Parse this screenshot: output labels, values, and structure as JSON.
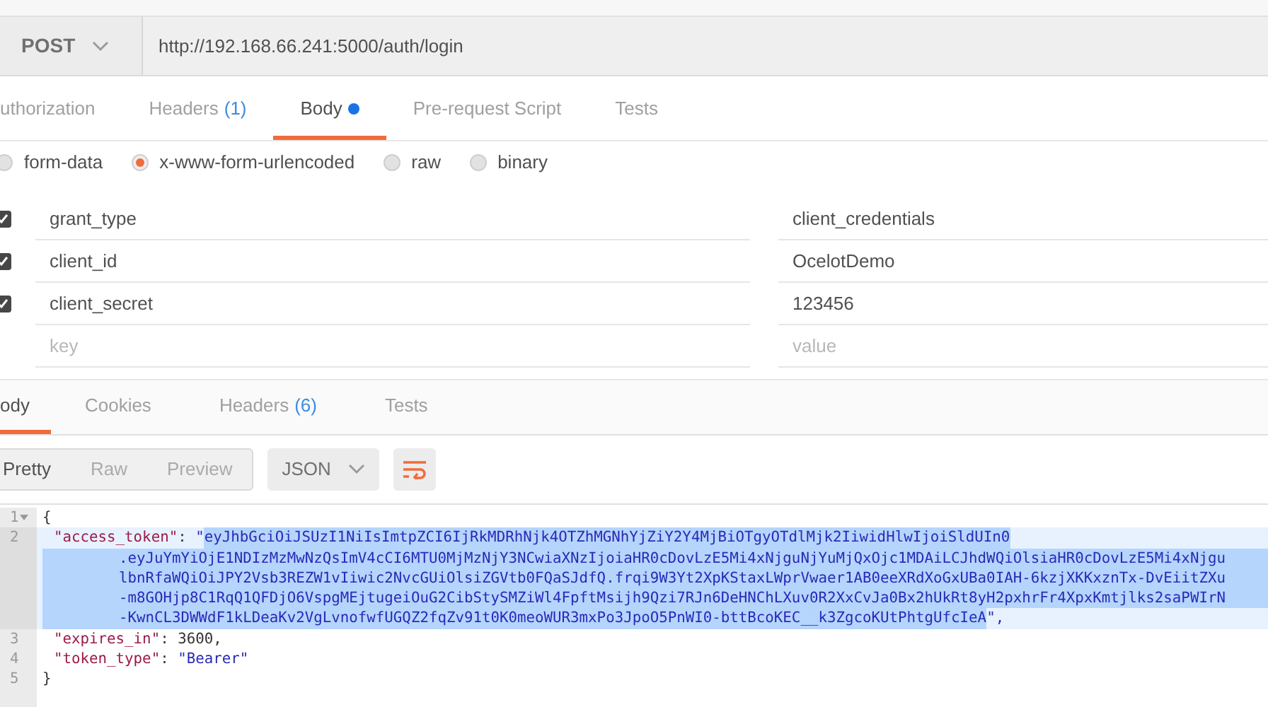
{
  "request": {
    "method": "POST",
    "url": "http://192.168.66.241:5000/auth/login"
  },
  "request_tabs": [
    {
      "label": "uthorization",
      "dot": false,
      "selected": false
    },
    {
      "label": "Headers",
      "count": "(1)",
      "dot": false,
      "selected": false
    },
    {
      "label": "Body",
      "dot": true,
      "selected": true
    },
    {
      "label": "Pre-request Script",
      "dot": false,
      "selected": false
    },
    {
      "label": "Tests",
      "dot": false,
      "selected": false
    }
  ],
  "body_modes": [
    {
      "label": "form-data",
      "selected": false
    },
    {
      "label": "x-www-form-urlencoded",
      "selected": true
    },
    {
      "label": "raw",
      "selected": false
    },
    {
      "label": "binary",
      "selected": false
    }
  ],
  "params": [
    {
      "checked": true,
      "key": "grant_type",
      "value": "client_credentials"
    },
    {
      "checked": true,
      "key": "client_id",
      "value": "OcelotDemo"
    },
    {
      "checked": true,
      "key": "client_secret",
      "value": "123456"
    }
  ],
  "new_param": {
    "key_placeholder": "key",
    "value_placeholder": "value"
  },
  "response_tabs": [
    {
      "label": "ody",
      "selected": true
    },
    {
      "label": "Cookies",
      "selected": false
    },
    {
      "label": "Headers",
      "count": "(6)",
      "selected": false
    },
    {
      "label": "Tests",
      "selected": false
    }
  ],
  "view_modes": [
    {
      "label": "Pretty",
      "selected": true
    },
    {
      "label": "Raw",
      "selected": false
    },
    {
      "label": "Preview",
      "selected": false
    }
  ],
  "format": "JSON",
  "code_lines": [
    {
      "number": "1",
      "kind": "punct",
      "foldable": true,
      "text": "{"
    },
    {
      "number": "2",
      "kind": "string",
      "foldable": false,
      "key": "\"access_token\"",
      "colon": ": ",
      "prefix": "\"",
      "selected": true,
      "value_lines": [
        "eyJhbGciOiJSUzI1NiIsImtpZCI6IjRkMDRhNjk4OTZhMGNhYjZiY2Y4MjBiOTgyOTdlMjk2IiwidHlwIjoiSldUIn0",
        ".eyJuYmYiOjE1NDIzMzMwNzQsImV4cCI6MTU0MjMzNjY3NCwiaXNzIjoiaHR0cDovLzE5Mi4xNjguNjYuMjQxOjc1MDAiLCJhdWQiOlsiaHR0cDovLzE5Mi4xNjgu",
        "lbnRfaWQiOiJPY2Vsb3REZW1vIiwic2NvcGUiOlsiZGVtb0FQaSJdfQ.frqi9W3Yt2XpKStaxLWprVwaer1AB0eeXRdXoGxUBa0IAH-6kzjXKKxznTx-DvEiitZXu",
        "-m8GOHjp8C1RqQ1QFDjO6VspgMEjtugeiOuG2CibStySMZiWl4FpftMsijh9Qzi7RJn6DeHNChLXuv0R2XxCvJa0Bx2hUkRt8yH2pxhrFr4XpxKmtjlks2saPWIrN",
        "-KwnCL3DWWdF1kLDeaKv2VgLvnofwfUGQZ2fqZv91t0K0meoWUR3mxPo3JpoO5PnWI0-bttBcoKEC__k3ZgcoKUtPhtgUfcIeA"
      ],
      "suffix": "\","
    },
    {
      "number": "3",
      "kind": "number",
      "foldable": false,
      "key": "\"expires_in\"",
      "colon": ": ",
      "text": "3600,"
    },
    {
      "number": "4",
      "kind": "string",
      "foldable": false,
      "key": "\"token_type\"",
      "colon": ": ",
      "text": "\"Bearer\""
    },
    {
      "number": "5",
      "kind": "punct",
      "foldable": false,
      "text": "}"
    }
  ]
}
